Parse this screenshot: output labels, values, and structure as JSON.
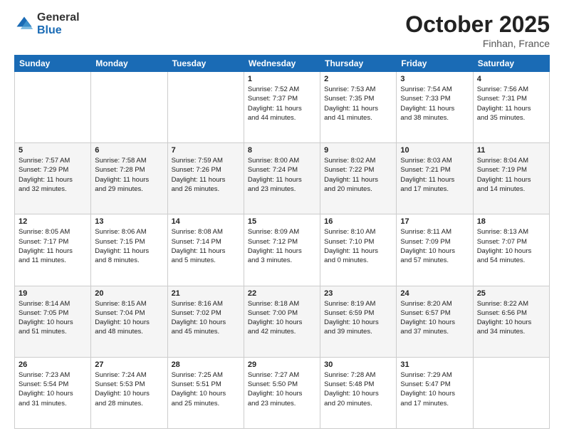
{
  "header": {
    "logo_general": "General",
    "logo_blue": "Blue",
    "month": "October 2025",
    "location": "Finhan, France"
  },
  "weekdays": [
    "Sunday",
    "Monday",
    "Tuesday",
    "Wednesday",
    "Thursday",
    "Friday",
    "Saturday"
  ],
  "weeks": [
    [
      {
        "day": "",
        "info": ""
      },
      {
        "day": "",
        "info": ""
      },
      {
        "day": "",
        "info": ""
      },
      {
        "day": "1",
        "info": "Sunrise: 7:52 AM\nSunset: 7:37 PM\nDaylight: 11 hours\nand 44 minutes."
      },
      {
        "day": "2",
        "info": "Sunrise: 7:53 AM\nSunset: 7:35 PM\nDaylight: 11 hours\nand 41 minutes."
      },
      {
        "day": "3",
        "info": "Sunrise: 7:54 AM\nSunset: 7:33 PM\nDaylight: 11 hours\nand 38 minutes."
      },
      {
        "day": "4",
        "info": "Sunrise: 7:56 AM\nSunset: 7:31 PM\nDaylight: 11 hours\nand 35 minutes."
      }
    ],
    [
      {
        "day": "5",
        "info": "Sunrise: 7:57 AM\nSunset: 7:29 PM\nDaylight: 11 hours\nand 32 minutes."
      },
      {
        "day": "6",
        "info": "Sunrise: 7:58 AM\nSunset: 7:28 PM\nDaylight: 11 hours\nand 29 minutes."
      },
      {
        "day": "7",
        "info": "Sunrise: 7:59 AM\nSunset: 7:26 PM\nDaylight: 11 hours\nand 26 minutes."
      },
      {
        "day": "8",
        "info": "Sunrise: 8:00 AM\nSunset: 7:24 PM\nDaylight: 11 hours\nand 23 minutes."
      },
      {
        "day": "9",
        "info": "Sunrise: 8:02 AM\nSunset: 7:22 PM\nDaylight: 11 hours\nand 20 minutes."
      },
      {
        "day": "10",
        "info": "Sunrise: 8:03 AM\nSunset: 7:21 PM\nDaylight: 11 hours\nand 17 minutes."
      },
      {
        "day": "11",
        "info": "Sunrise: 8:04 AM\nSunset: 7:19 PM\nDaylight: 11 hours\nand 14 minutes."
      }
    ],
    [
      {
        "day": "12",
        "info": "Sunrise: 8:05 AM\nSunset: 7:17 PM\nDaylight: 11 hours\nand 11 minutes."
      },
      {
        "day": "13",
        "info": "Sunrise: 8:06 AM\nSunset: 7:15 PM\nDaylight: 11 hours\nand 8 minutes."
      },
      {
        "day": "14",
        "info": "Sunrise: 8:08 AM\nSunset: 7:14 PM\nDaylight: 11 hours\nand 5 minutes."
      },
      {
        "day": "15",
        "info": "Sunrise: 8:09 AM\nSunset: 7:12 PM\nDaylight: 11 hours\nand 3 minutes."
      },
      {
        "day": "16",
        "info": "Sunrise: 8:10 AM\nSunset: 7:10 PM\nDaylight: 11 hours\nand 0 minutes."
      },
      {
        "day": "17",
        "info": "Sunrise: 8:11 AM\nSunset: 7:09 PM\nDaylight: 10 hours\nand 57 minutes."
      },
      {
        "day": "18",
        "info": "Sunrise: 8:13 AM\nSunset: 7:07 PM\nDaylight: 10 hours\nand 54 minutes."
      }
    ],
    [
      {
        "day": "19",
        "info": "Sunrise: 8:14 AM\nSunset: 7:05 PM\nDaylight: 10 hours\nand 51 minutes."
      },
      {
        "day": "20",
        "info": "Sunrise: 8:15 AM\nSunset: 7:04 PM\nDaylight: 10 hours\nand 48 minutes."
      },
      {
        "day": "21",
        "info": "Sunrise: 8:16 AM\nSunset: 7:02 PM\nDaylight: 10 hours\nand 45 minutes."
      },
      {
        "day": "22",
        "info": "Sunrise: 8:18 AM\nSunset: 7:00 PM\nDaylight: 10 hours\nand 42 minutes."
      },
      {
        "day": "23",
        "info": "Sunrise: 8:19 AM\nSunset: 6:59 PM\nDaylight: 10 hours\nand 39 minutes."
      },
      {
        "day": "24",
        "info": "Sunrise: 8:20 AM\nSunset: 6:57 PM\nDaylight: 10 hours\nand 37 minutes."
      },
      {
        "day": "25",
        "info": "Sunrise: 8:22 AM\nSunset: 6:56 PM\nDaylight: 10 hours\nand 34 minutes."
      }
    ],
    [
      {
        "day": "26",
        "info": "Sunrise: 7:23 AM\nSunset: 5:54 PM\nDaylight: 10 hours\nand 31 minutes."
      },
      {
        "day": "27",
        "info": "Sunrise: 7:24 AM\nSunset: 5:53 PM\nDaylight: 10 hours\nand 28 minutes."
      },
      {
        "day": "28",
        "info": "Sunrise: 7:25 AM\nSunset: 5:51 PM\nDaylight: 10 hours\nand 25 minutes."
      },
      {
        "day": "29",
        "info": "Sunrise: 7:27 AM\nSunset: 5:50 PM\nDaylight: 10 hours\nand 23 minutes."
      },
      {
        "day": "30",
        "info": "Sunrise: 7:28 AM\nSunset: 5:48 PM\nDaylight: 10 hours\nand 20 minutes."
      },
      {
        "day": "31",
        "info": "Sunrise: 7:29 AM\nSunset: 5:47 PM\nDaylight: 10 hours\nand 17 minutes."
      },
      {
        "day": "",
        "info": ""
      }
    ]
  ]
}
